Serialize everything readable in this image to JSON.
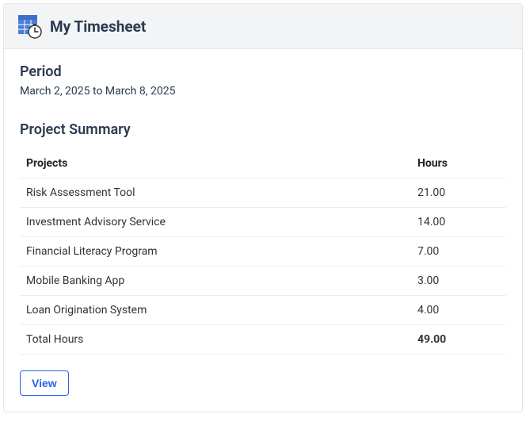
{
  "header": {
    "title": "My Timesheet",
    "icon": "timesheet-icon"
  },
  "period": {
    "label": "Period",
    "value": "March 2, 2025 to March 8, 2025"
  },
  "summary": {
    "title": "Project Summary",
    "columns": {
      "projects": "Projects",
      "hours": "Hours"
    },
    "rows": [
      {
        "project": "Risk Assessment Tool",
        "hours": "21.00"
      },
      {
        "project": "Investment Advisory Service",
        "hours": "14.00"
      },
      {
        "project": "Financial Literacy Program",
        "hours": "7.00"
      },
      {
        "project": "Mobile Banking App",
        "hours": "3.00"
      },
      {
        "project": "Loan Origination System",
        "hours": "4.00"
      }
    ],
    "total": {
      "label": "Total Hours",
      "hours": "49.00"
    }
  },
  "actions": {
    "view": "View"
  }
}
